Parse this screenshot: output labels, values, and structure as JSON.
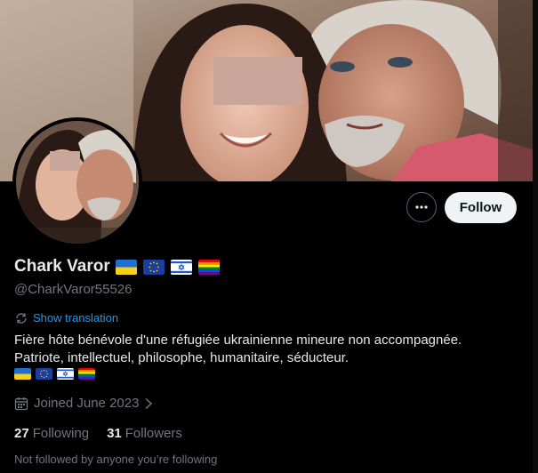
{
  "profile": {
    "name": "Chark Varor",
    "handle": "@CharkVaror55526",
    "name_flags": [
      "ukraine-flag",
      "eu-flag",
      "israel-flag",
      "rainbow-flag"
    ],
    "follow_label": "Follow",
    "more_icon": "more-horizontal-icon"
  },
  "bio": {
    "show_translation": "Show translation",
    "line1": "Fière hôte bénévole d'une réfugiée ukrainienne mineure non accompagnée.",
    "line2": "Patriote, intellectuel, philosophe, humanitaire, séducteur.",
    "flags": [
      "ukraine-flag",
      "eu-flag",
      "israel-flag",
      "rainbow-flag"
    ]
  },
  "meta": {
    "joined": "Joined June 2023"
  },
  "stats": {
    "following_count": "27",
    "following_label": "Following",
    "followers_count": "31",
    "followers_label": "Followers"
  },
  "footer": {
    "not_followed": "Not followed by anyone you’re following"
  },
  "colors": {
    "background": "#000000",
    "link": "#1d9bf0",
    "muted": "#71767b",
    "text": "#e7e9ea",
    "follow_bg": "#eff3f4"
  }
}
